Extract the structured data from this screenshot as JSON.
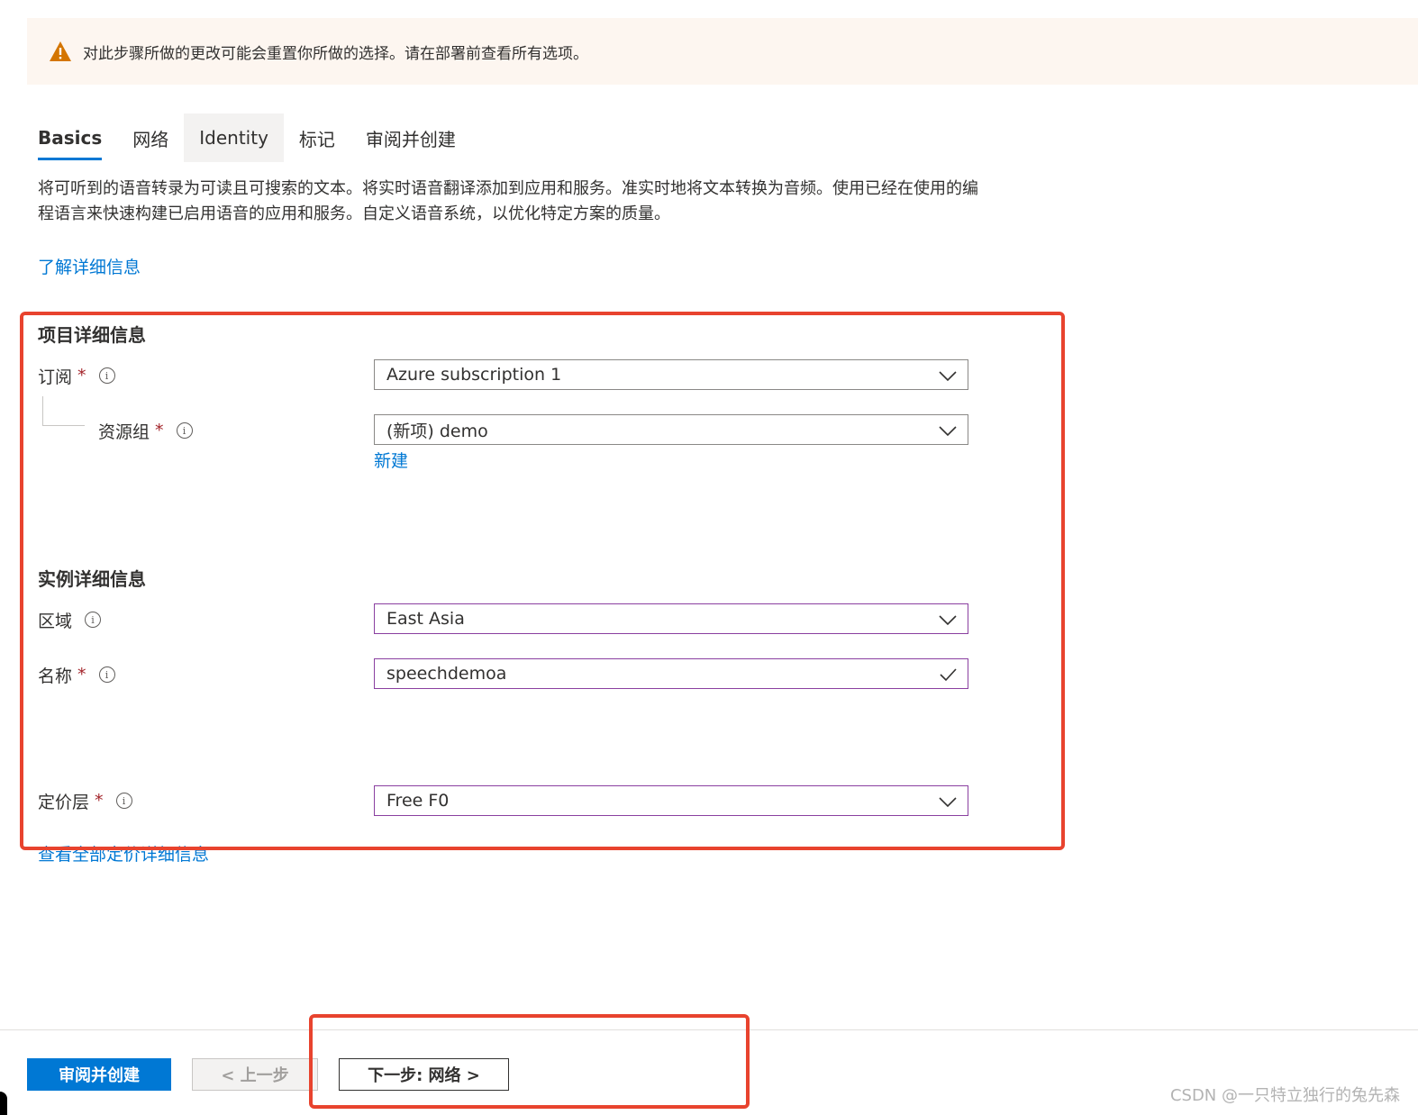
{
  "banner": {
    "text": "对此步骤所做的更改可能会重置你所做的选择。请在部署前查看所有选项。",
    "icon": "warning-icon",
    "icon_color": "#d47500"
  },
  "tabs": [
    {
      "label": "Basics",
      "active": true
    },
    {
      "label": "网络"
    },
    {
      "label": "Identity"
    },
    {
      "label": "标记"
    },
    {
      "label": "审阅并创建"
    }
  ],
  "description": "将可听到的语音转录为可读且可搜索的文本。将实时语音翻译添加到应用和服务。准实时地将文本转换为音频。使用已经在使用的编程语言来快速构建已启用语音的应用和服务。自定义语音系统，以优化特定方案的质量。",
  "learn_more": "了解详细信息",
  "project": {
    "title": "项目详细信息",
    "subscription": {
      "label": "订阅",
      "required": "*",
      "value": "Azure subscription 1"
    },
    "resource_group": {
      "label": "资源组",
      "required": "*",
      "value": "(新项) demo",
      "new_link": "新建"
    }
  },
  "instance": {
    "title": "实例详细信息",
    "region": {
      "label": "区域",
      "value": "East Asia"
    },
    "name": {
      "label": "名称",
      "required": "*",
      "value": "speechdemoa"
    },
    "pricing": {
      "label": "定价层",
      "required": "*",
      "value": "Free F0",
      "details_link": "查看全部定价详细信息"
    }
  },
  "footer": {
    "review_create": "审阅并创建",
    "previous": "< 上一步",
    "next": "下一步: 网络 >"
  },
  "watermark": "CSDN @一只特立独行的兔先森",
  "colors": {
    "accent": "#0078d4",
    "highlight_box": "#e8432e",
    "valid_border": "#8a3fa0",
    "required": "#a4262c"
  }
}
